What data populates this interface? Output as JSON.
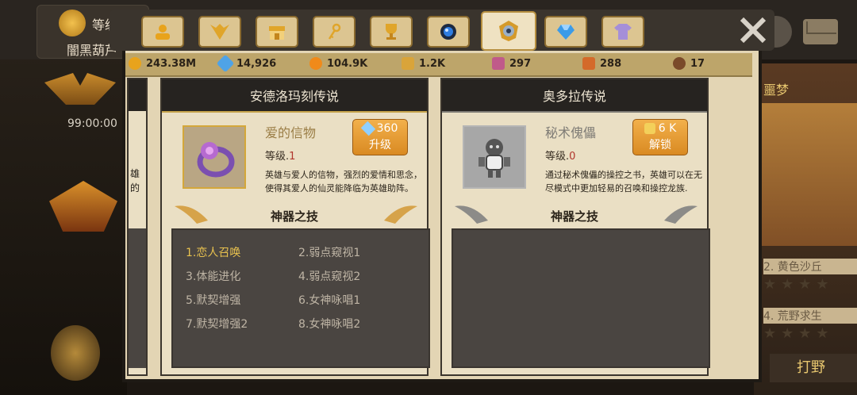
{
  "header": {
    "level_label": "等级",
    "player_name": "闇黑葫芦"
  },
  "background": {
    "timer": "99:00:00",
    "left_text": [
      "雄",
      "的"
    ],
    "right_tag": "噩梦",
    "right_items": [
      "2. 黄色沙丘",
      "4. 荒野求生"
    ],
    "farm_button": "打野"
  },
  "tabs": [
    {
      "name": "hero-tab",
      "icon": "person-icon"
    },
    {
      "name": "dragon-tab",
      "icon": "dragon-icon"
    },
    {
      "name": "shop-tab",
      "icon": "shop-icon"
    },
    {
      "name": "key-tab",
      "icon": "key-icon"
    },
    {
      "name": "trophy-tab",
      "icon": "trophy-icon"
    },
    {
      "name": "orb-tab",
      "icon": "orb-icon"
    },
    {
      "name": "artifact-tab",
      "icon": "artifact-icon",
      "active": true
    },
    {
      "name": "gem-tab",
      "icon": "gem-icon"
    },
    {
      "name": "outfit-tab",
      "icon": "shirt-icon"
    }
  ],
  "resources": [
    {
      "icon": "coin-icon",
      "value": "243.38M",
      "color": "#e8a31c"
    },
    {
      "icon": "diamond-icon",
      "value": "14,926",
      "color": "#4fa3e6"
    },
    {
      "icon": "orange-orb-icon",
      "value": "104.9K",
      "color": "#f08a1a"
    },
    {
      "icon": "puzzle-gold-icon",
      "value": "1.2K",
      "color": "#d9a43a"
    },
    {
      "icon": "puzzle-pink-icon",
      "value": "297",
      "color": "#c05a8a"
    },
    {
      "icon": "puzzle-orange-icon",
      "value": "288",
      "color": "#d46a2a"
    },
    {
      "icon": "medal-icon",
      "value": "17",
      "color": "#7a4a2a"
    }
  ],
  "cards": [
    {
      "title": "安德洛玛刻传说",
      "item_name": "爱的信物",
      "level_label": "等级.",
      "level_value": "1",
      "button_cost": "360",
      "button_label": "升级",
      "description": "英雄与爱人的信物，强烈的爱情和思念，使得其爱人的仙灵能降临为英雄助阵。",
      "skills_title": "神器之技",
      "skills": [
        {
          "text": "1.恋人召唤",
          "active": true
        },
        {
          "text": "2.弱点窥视1",
          "active": false
        },
        {
          "text": "3.体能进化",
          "active": false
        },
        {
          "text": "4.弱点窥视2",
          "active": false
        },
        {
          "text": "5.默契增强",
          "active": false
        },
        {
          "text": "6.女神咏唱1",
          "active": false
        },
        {
          "text": "7.默契增强2",
          "active": false
        },
        {
          "text": "8.女神咏唱2",
          "active": false
        }
      ]
    },
    {
      "title": "奥多拉传说",
      "item_name": "秘术傀儡",
      "level_label": "等级.",
      "level_value": "0",
      "button_cost": "6 K",
      "button_label": "解锁",
      "description": "通过秘术傀儡的操控之书，英雄可以在无尽模式中更加轻易的召唤和操控龙族.",
      "skills_title": "神器之技"
    }
  ]
}
